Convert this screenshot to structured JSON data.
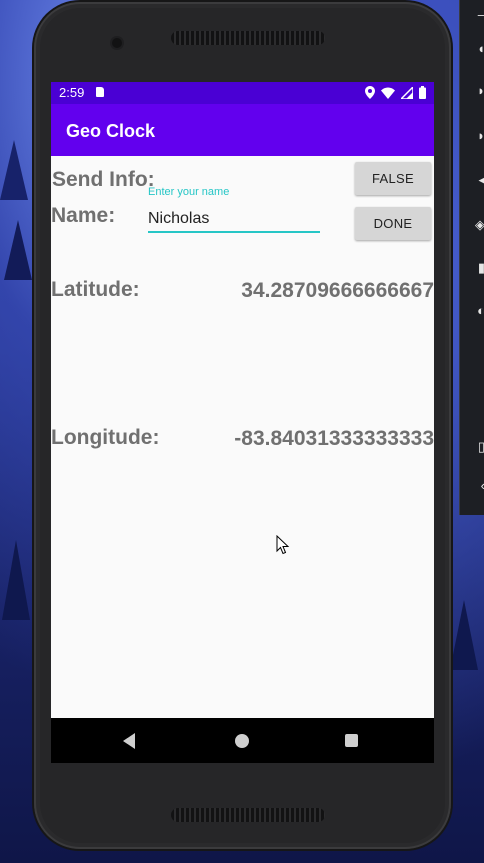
{
  "status_bar": {
    "time": "2:59",
    "icons": [
      "sd-card-icon",
      "location-icon",
      "wifi-icon",
      "signal-icon",
      "battery-icon"
    ]
  },
  "app_bar": {
    "title": "Geo Clock"
  },
  "form": {
    "send_info_label": "Send Info:",
    "send_info_button": "FALSE",
    "name_label": "Name:",
    "name_hint": "Enter your name",
    "name_value": "Nicholas",
    "done_button": "DONE"
  },
  "location": {
    "latitude_label": "Latitude:",
    "latitude_value": "34.28709666666667",
    "longitude_label": "Longitude:",
    "longitude_value": "-83.84031333333333"
  },
  "nav": {
    "icons": [
      "back-icon",
      "home-icon",
      "recents-icon"
    ]
  },
  "colors": {
    "status_bar": "#4a00d4",
    "app_bar": "#6200ee",
    "accent": "#26c6c6",
    "label_text": "#707070"
  }
}
